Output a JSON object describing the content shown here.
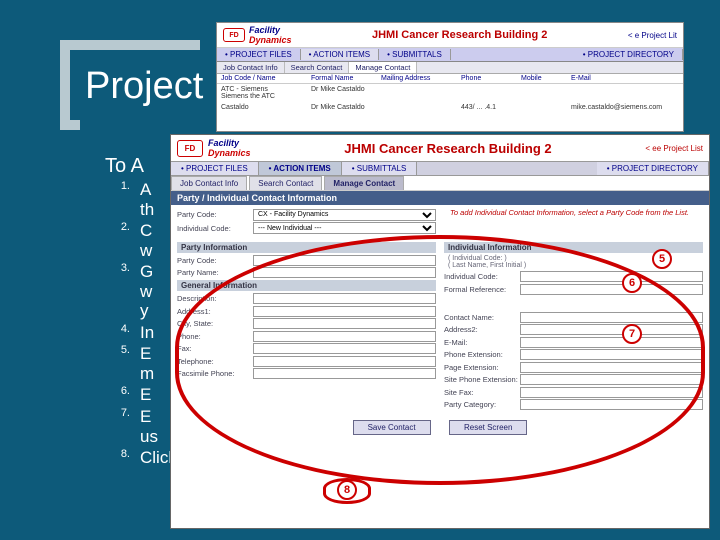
{
  "slide": {
    "title": "Project",
    "intro": "To A",
    "steps": [
      {
        "n": "1.",
        "t": "A\nth"
      },
      {
        "n": "2.",
        "t": "C\nw"
      },
      {
        "n": "3.",
        "t": "G\nw\ny"
      },
      {
        "n": "4.",
        "t": "In"
      },
      {
        "n": "5.",
        "t": "E\nm"
      },
      {
        "n": "6.",
        "t": "E"
      },
      {
        "n": "7.",
        "t": "E\nus"
      },
      {
        "n": "8.",
        "t": "Click Sav"
      }
    ]
  },
  "back_window": {
    "logo": "FD",
    "company_f": "Facility",
    "company_d": "Dynamics",
    "title": "JHMI Cancer Research Building 2",
    "link": "< e  Project Lit",
    "tabs": [
      "• PROJECT FILES",
      "• ACTION ITEMS",
      "• SUBMITTALS",
      "• PROJECT DIRECTORY"
    ],
    "subtabs": [
      "Job Contact Info",
      "Search Contact",
      "Manage Contact"
    ],
    "cols": [
      "Job Code / Name",
      "Formal Name",
      "Mailing Address",
      "Phone",
      "Mobile",
      "E-Mail"
    ],
    "row1_name": "ATC - Siemens\nSiemens the ATC",
    "row2_name": "Castaldo",
    "row2_formal": "Dr Mike Castaldo",
    "row2_phone": "443/ ...  .4.1",
    "row2_email": "mike.castaldo@siemens.com"
  },
  "front_window": {
    "logo": "FD",
    "company_f": "Facility",
    "company_d": "Dynamics",
    "title": "JHMI Cancer Research Building 2",
    "link": "< ee Project List",
    "tabs": [
      "• PROJECT FILES",
      "• ACTION ITEMS",
      "• SUBMITTALS",
      "• PROJECT DIRECTORY"
    ],
    "subtabs": [
      "Job Contact Info",
      "Search Contact",
      "Manage Contact"
    ],
    "banner": "Party / Individual Contact Information",
    "note": "To add Individual Contact Information, select a Party Code from the List.",
    "labels": {
      "party_code": "Party Code:",
      "individual_code": "Individual Code:",
      "party_code2": "Party Code:",
      "party_name": "Party Name:",
      "description": "Description:",
      "address1": "Address1:",
      "city_state": "City, State:",
      "phone": "Phone:",
      "fax": "Fax:",
      "telephone": "Telephone:",
      "facsimile": "Facsimile Phone:",
      "individual_code2": "Individual Code:",
      "formal_ref": "Formal Reference:",
      "contact_name": "Contact Name:",
      "address2": "Address2:",
      "email": "E-Mail:",
      "phone_ext": "Phone Extension:",
      "page_ext": "Page Extension:",
      "site_phone_ext": "Site Phone Extension:",
      "site_fax": "Site Fax:",
      "party_category": "Party Category:"
    },
    "selects": {
      "party_code_val": "CX - Facility Dynamics",
      "individual_val": "--- New Individual ---"
    },
    "sections": {
      "party_info": "Party Information",
      "general_info": "General Information",
      "individual_info": "Individual Information",
      "individual_hint": "( Individual Code: )\n( Last Name, First Initial )"
    },
    "buttons": {
      "save": "Save Contact",
      "reset": "Reset Screen"
    }
  },
  "annotations": {
    "five": "5",
    "six": "6",
    "seven": "7",
    "eight": "8"
  }
}
